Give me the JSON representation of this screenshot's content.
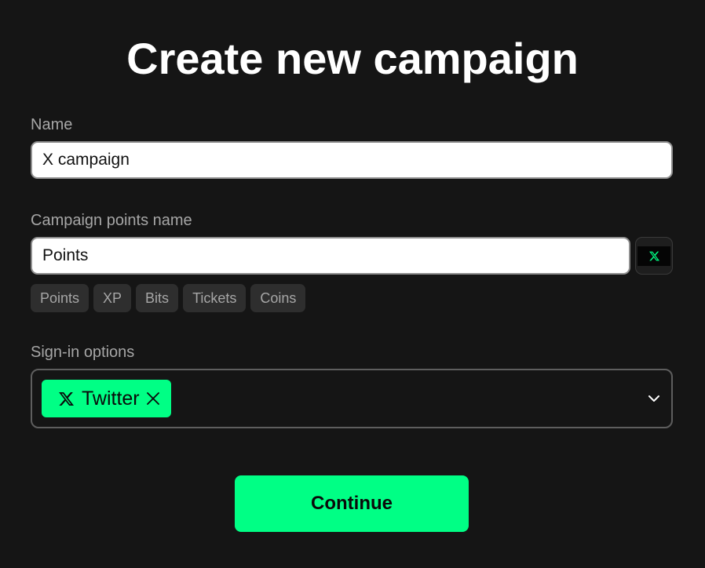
{
  "page": {
    "title": "Create new campaign"
  },
  "form": {
    "name": {
      "label": "Name",
      "value": "X campaign"
    },
    "points_name": {
      "label": "Campaign points name",
      "value": "Points",
      "icon": "x-logo-icon",
      "suggestions": [
        "Points",
        "XP",
        "Bits",
        "Tickets",
        "Coins"
      ]
    },
    "sign_in": {
      "label": "Sign-in options",
      "selected": [
        {
          "label": "Twitter",
          "icon": "x-logo-icon"
        }
      ],
      "dropdown_icon": "chevron-down-icon"
    },
    "continue_label": "Continue"
  },
  "colors": {
    "background": "#151515",
    "accent": "#00ff85",
    "chip_bg": "#2e2e2e",
    "label_text": "#a6a6a6"
  }
}
